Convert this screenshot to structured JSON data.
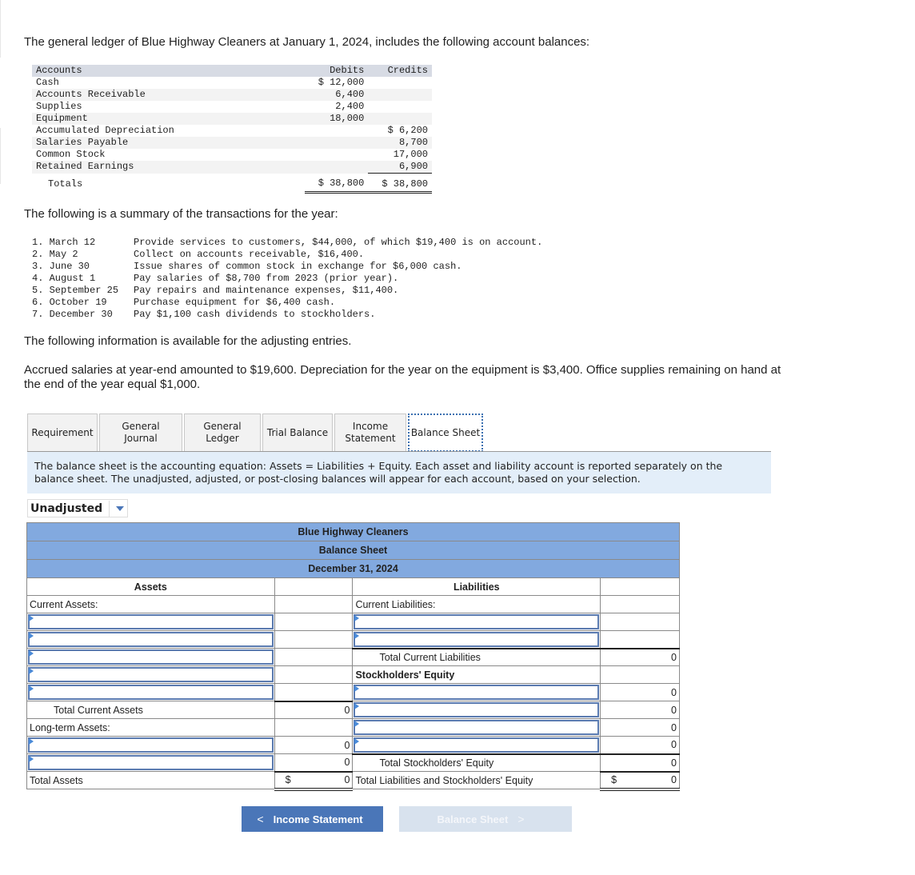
{
  "intro": "The general ledger of Blue Highway Cleaners at January 1, 2024, includes the following account balances:",
  "ledger": {
    "headers": [
      "Accounts",
      "Debits",
      "Credits"
    ],
    "rows": [
      {
        "account": "Cash",
        "debit": "$ 12,000",
        "credit": ""
      },
      {
        "account": "Accounts Receivable",
        "debit": "6,400",
        "credit": ""
      },
      {
        "account": "Supplies",
        "debit": "2,400",
        "credit": ""
      },
      {
        "account": "Equipment",
        "debit": "18,000",
        "credit": ""
      },
      {
        "account": "Accumulated Depreciation",
        "debit": "",
        "credit": "$ 6,200"
      },
      {
        "account": "Salaries Payable",
        "debit": "",
        "credit": "8,700"
      },
      {
        "account": "Common Stock",
        "debit": "",
        "credit": "17,000"
      },
      {
        "account": "Retained Earnings",
        "debit": "",
        "credit": "6,900"
      }
    ],
    "totals": {
      "label": "Totals",
      "debit": "$ 38,800",
      "credit": "$ 38,800"
    }
  },
  "transactions_intro": "The following is a summary of the transactions for the year:",
  "transactions": [
    {
      "date": "1. March 12",
      "text": "Provide services to customers, $44,000, of which $19,400 is on account."
    },
    {
      "date": "2. May 2",
      "text": "Collect on accounts receivable, $16,400."
    },
    {
      "date": "3. June 30",
      "text": "Issue shares of common stock in exchange for $6,000 cash."
    },
    {
      "date": "4. August 1",
      "text": "Pay salaries of $8,700 from 2023 (prior year)."
    },
    {
      "date": "5. September 25",
      "text": "Pay repairs and maintenance expenses, $11,400."
    },
    {
      "date": "6. October 19",
      "text": "Purchase equipment for $6,400 cash."
    },
    {
      "date": "7. December 30",
      "text": "Pay $1,100 cash dividends to stockholders."
    }
  ],
  "adjusting_intro": "The following information is available for the adjusting entries.",
  "adjusting_text": "Accrued salaries at year-end amounted to $19,600. Depreciation for the year on the equipment is $3,400. Office supplies remaining on hand at the end of the year equal $1,000.",
  "tabs": [
    {
      "label": "Requirement"
    },
    {
      "label": "General Journal"
    },
    {
      "label": "General Ledger"
    },
    {
      "label": "Trial Balance"
    },
    {
      "label": "Income Statement"
    },
    {
      "label": "Balance Sheet",
      "active": true
    }
  ],
  "info_text": "The balance sheet is the accounting equation: Assets = Liabilities + Equity. Each asset and liability account is reported separately on the balance sheet. The unadjusted, adjusted, or post-closing balances will appear for each account, based on your selection.",
  "dropdown": {
    "selected": "Unadjusted"
  },
  "balance_sheet": {
    "company": "Blue Highway Cleaners",
    "title": "Balance Sheet",
    "date": "December 31, 2024",
    "assets_header": "Assets",
    "liabilities_header": "Liabilities",
    "current_assets_label": "Current Assets:",
    "current_liabilities_label": "Current Liabilities:",
    "total_current_liabilities_label": "Total Current Liabilities",
    "total_current_liabilities": "0",
    "stockholders_equity_label": "Stockholders' Equity",
    "equity_values": [
      "0",
      "0",
      "0",
      "0"
    ],
    "total_current_assets_label": "Total Current Assets",
    "total_current_assets": "0",
    "long_term_assets_label": "Long-term Assets:",
    "long_term_values": [
      "0",
      "0"
    ],
    "total_stockholders_equity_label": "Total Stockholders' Equity",
    "total_stockholders_equity": "0",
    "total_assets_label": "Total Assets",
    "total_assets": "0",
    "total_liab_equity_label": "Total Liabilities and Stockholders' Equity",
    "total_liab_equity": "0",
    "currency": "$"
  },
  "nav": {
    "prev": "Income Statement",
    "next": "Balance Sheet"
  }
}
